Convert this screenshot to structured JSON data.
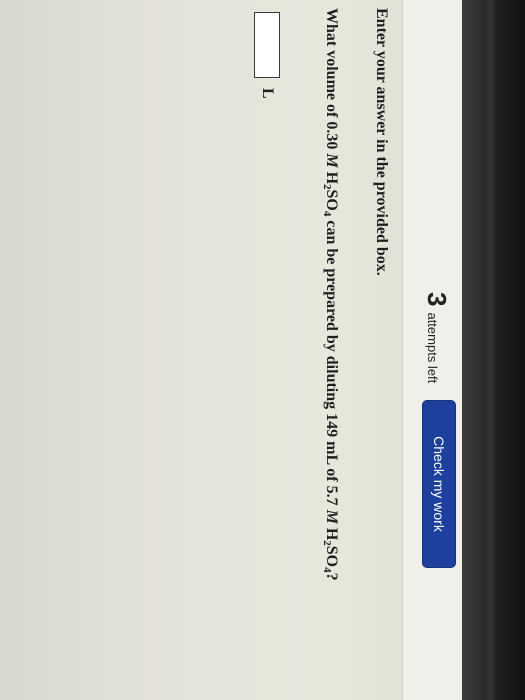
{
  "header": {
    "attempts_count": "3",
    "attempts_label": "attempts left",
    "check_button_label": "Check my work"
  },
  "question": {
    "instruction": "Enter your answer in the provided box.",
    "prompt_start": "What volume of 0.30 ",
    "molarity_unit_1": "M",
    "acid_1_a": " H",
    "acid_1_sub_a": "2",
    "acid_1_b": "SO",
    "acid_1_sub_b": "4",
    "prompt_mid": " can be prepared by diluting 149 mL of 5.7 ",
    "molarity_unit_2": "M",
    "acid_2_a": " H",
    "acid_2_sub_a": "2",
    "acid_2_b": "SO",
    "acid_2_sub_b": "4",
    "prompt_end": "?"
  },
  "answer": {
    "value": "",
    "unit": "L"
  }
}
